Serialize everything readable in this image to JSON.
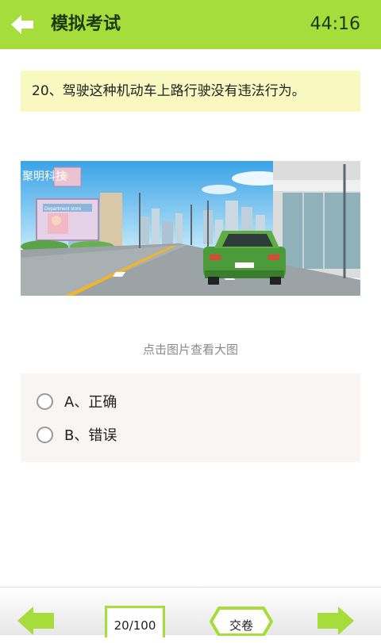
{
  "header": {
    "title": "模拟考试",
    "timer": "44:16",
    "back_icon": "back-arrow-icon"
  },
  "question": {
    "text": "20、驾驶这种机动车上路行驶没有违法行为。"
  },
  "image": {
    "watermark": "聚明科技",
    "billboard_text": "Department store",
    "hint": "点击图片查看大图"
  },
  "options": [
    {
      "label": "A、正确",
      "selected": false
    },
    {
      "label": "B、错误",
      "selected": false
    }
  ],
  "footer": {
    "counter": "20/100",
    "submit_label": "交卷",
    "prev_icon": "prev-arrow-icon",
    "next_icon": "next-arrow-icon"
  },
  "colors": {
    "accent": "#a6dd3b",
    "question_bg": "#f9f8c1",
    "options_bg": "#f8f5f3"
  }
}
